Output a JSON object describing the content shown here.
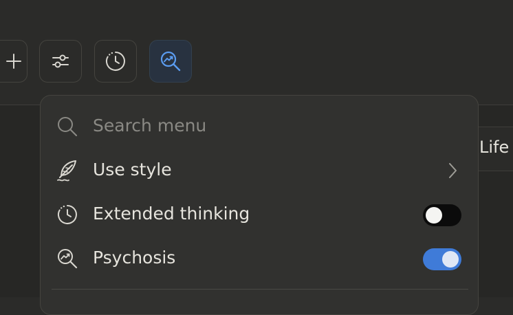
{
  "toolbar": {
    "buttons": [
      {
        "name": "add",
        "icon": "plus-icon",
        "active": false
      },
      {
        "name": "tools",
        "icon": "sliders-icon",
        "active": false
      },
      {
        "name": "extended-thinking",
        "icon": "clock-icon",
        "active": false
      },
      {
        "name": "research",
        "icon": "trend-search-icon",
        "active": true
      }
    ]
  },
  "background": {
    "partial_tab_label": "Life"
  },
  "menu": {
    "search": {
      "placeholder": "Search menu",
      "icon": "search-icon"
    },
    "items": [
      {
        "label": "Use style",
        "icon": "feather-icon",
        "control": "chevron-right-icon"
      },
      {
        "label": "Extended thinking",
        "icon": "clock-icon",
        "control": "toggle",
        "enabled": false
      },
      {
        "label": "Psychosis",
        "icon": "trend-search-icon",
        "control": "toggle",
        "enabled": true
      }
    ]
  },
  "colors": {
    "background": "#2b2b29",
    "menu_background": "#31312f",
    "accent_blue": "#3f7bd8",
    "active_button_bg": "#283240",
    "text_primary": "#e6e4dd",
    "text_placeholder": "#8a8984"
  }
}
